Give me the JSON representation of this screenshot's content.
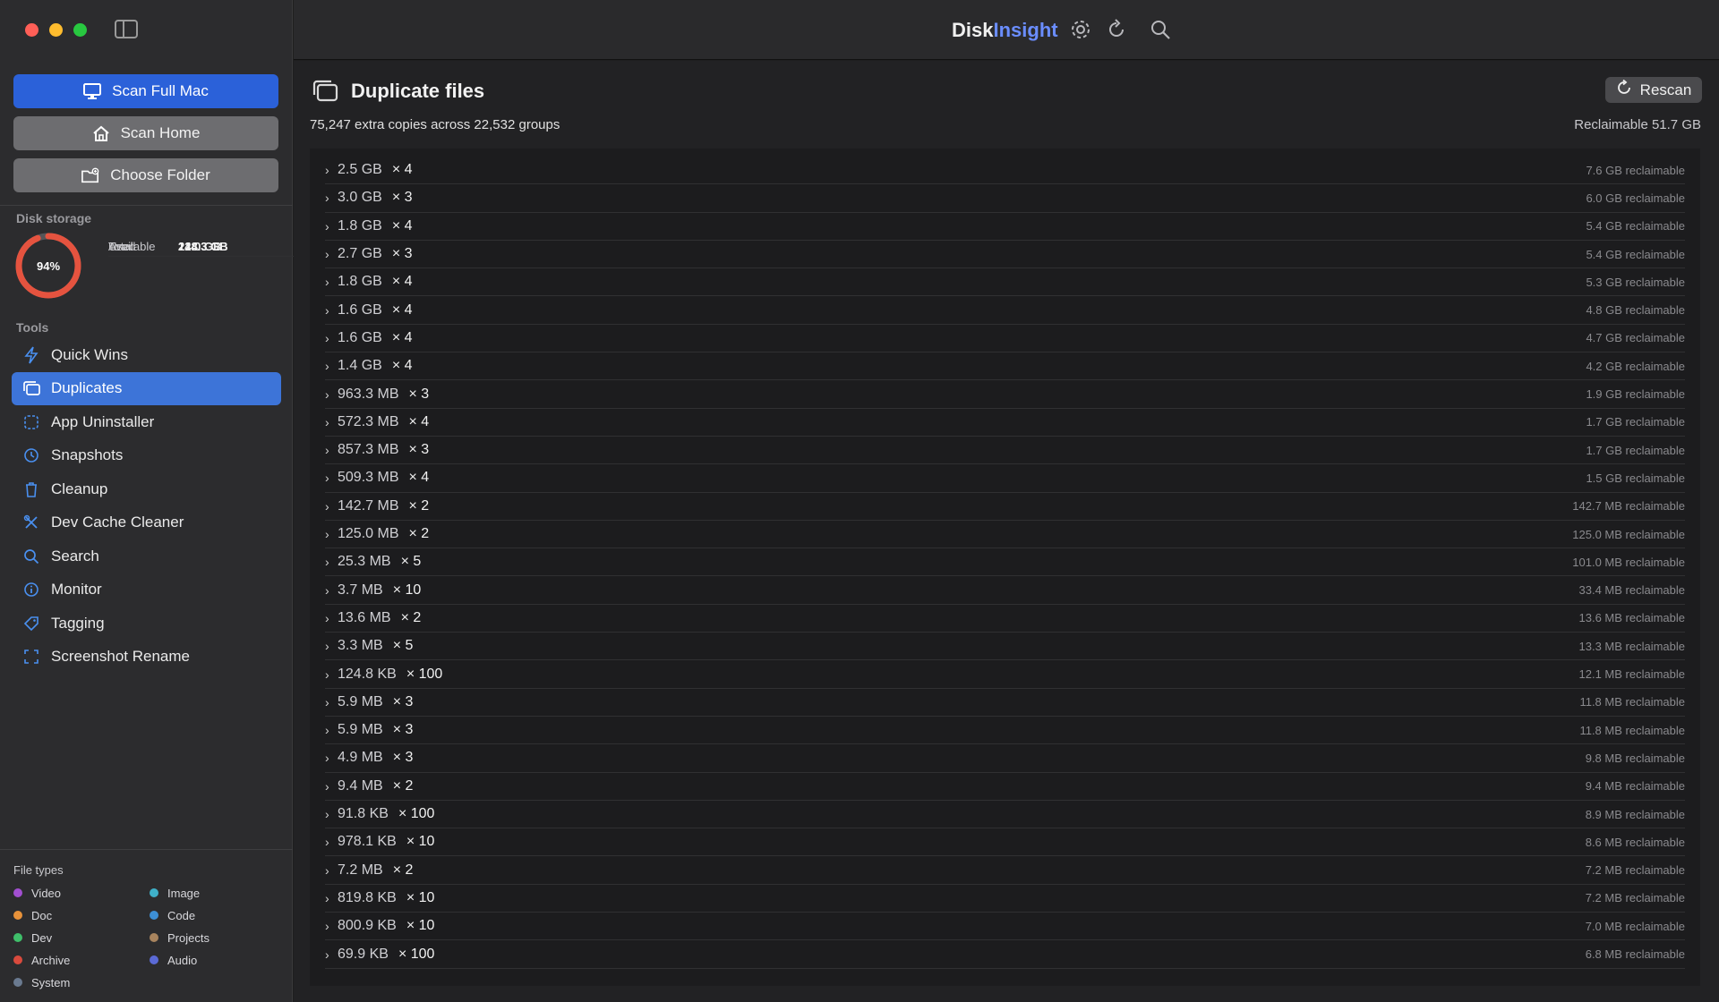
{
  "app": {
    "brand_part1": "Disk",
    "brand_part2": "Insight"
  },
  "sidebar": {
    "scan_full": "Scan Full Mac",
    "scan_home": "Scan Home",
    "choose_folder": "Choose Folder",
    "disk_title": "Disk storage",
    "disk_percent": "94%",
    "disk_used_fraction": 0.94,
    "stats": {
      "total_label": "Total",
      "total": "228.3 GB",
      "used_label": "Used",
      "used": "214.3 GB",
      "available_label": "Available",
      "available": "14.0 GB"
    },
    "tools_title": "Tools",
    "tools": [
      {
        "label": "Quick Wins",
        "icon": "bolt-icon"
      },
      {
        "label": "Duplicates",
        "icon": "duplicates-icon",
        "active": true
      },
      {
        "label": "App Uninstaller",
        "icon": "app-icon"
      },
      {
        "label": "Snapshots",
        "icon": "clock-icon"
      },
      {
        "label": "Cleanup",
        "icon": "trash-icon"
      },
      {
        "label": "Dev Cache Cleaner",
        "icon": "tools-icon"
      },
      {
        "label": "Search",
        "icon": "search-icon"
      },
      {
        "label": "Monitor",
        "icon": "info-icon"
      },
      {
        "label": "Tagging",
        "icon": "tag-icon"
      },
      {
        "label": "Screenshot Rename",
        "icon": "screenshot-icon"
      }
    ],
    "filetypes_title": "File types",
    "filetypes": [
      {
        "label": "Video",
        "color": "#a24fd0"
      },
      {
        "label": "Image",
        "color": "#3fb0c8"
      },
      {
        "label": "Doc",
        "color": "#e8923a"
      },
      {
        "label": "Code",
        "color": "#3d8fd6"
      },
      {
        "label": "Dev",
        "color": "#3fbf6a"
      },
      {
        "label": "Projects",
        "color": "#a8845e"
      },
      {
        "label": "Archive",
        "color": "#d94a3d"
      },
      {
        "label": "Audio",
        "color": "#5b6ad6"
      },
      {
        "label": "System",
        "color": "#6a7a90"
      }
    ]
  },
  "main": {
    "title": "Duplicate files",
    "rescan": "Rescan",
    "summary": "75,247 extra copies across 22,532 groups",
    "reclaimable": "Reclaimable 51.7 GB",
    "rows": [
      {
        "size": "2.5 GB",
        "count": "× 4",
        "reclaim": "7.6 GB reclaimable"
      },
      {
        "size": "3.0 GB",
        "count": "× 3",
        "reclaim": "6.0 GB reclaimable"
      },
      {
        "size": "1.8 GB",
        "count": "× 4",
        "reclaim": "5.4 GB reclaimable"
      },
      {
        "size": "2.7 GB",
        "count": "× 3",
        "reclaim": "5.4 GB reclaimable"
      },
      {
        "size": "1.8 GB",
        "count": "× 4",
        "reclaim": "5.3 GB reclaimable"
      },
      {
        "size": "1.6 GB",
        "count": "× 4",
        "reclaim": "4.8 GB reclaimable"
      },
      {
        "size": "1.6 GB",
        "count": "× 4",
        "reclaim": "4.7 GB reclaimable"
      },
      {
        "size": "1.4 GB",
        "count": "× 4",
        "reclaim": "4.2 GB reclaimable"
      },
      {
        "size": "963.3 MB",
        "count": "× 3",
        "reclaim": "1.9 GB reclaimable"
      },
      {
        "size": "572.3 MB",
        "count": "× 4",
        "reclaim": "1.7 GB reclaimable"
      },
      {
        "size": "857.3 MB",
        "count": "× 3",
        "reclaim": "1.7 GB reclaimable"
      },
      {
        "size": "509.3 MB",
        "count": "× 4",
        "reclaim": "1.5 GB reclaimable"
      },
      {
        "size": "142.7 MB",
        "count": "× 2",
        "reclaim": "142.7 MB reclaimable"
      },
      {
        "size": "125.0 MB",
        "count": "× 2",
        "reclaim": "125.0 MB reclaimable"
      },
      {
        "size": "25.3 MB",
        "count": "× 5",
        "reclaim": "101.0 MB reclaimable"
      },
      {
        "size": "3.7 MB",
        "count": "× 10",
        "reclaim": "33.4 MB reclaimable"
      },
      {
        "size": "13.6 MB",
        "count": "× 2",
        "reclaim": "13.6 MB reclaimable"
      },
      {
        "size": "3.3 MB",
        "count": "× 5",
        "reclaim": "13.3 MB reclaimable"
      },
      {
        "size": "124.8 KB",
        "count": "× 100",
        "reclaim": "12.1 MB reclaimable"
      },
      {
        "size": "5.9 MB",
        "count": "× 3",
        "reclaim": "11.8 MB reclaimable"
      },
      {
        "size": "5.9 MB",
        "count": "× 3",
        "reclaim": "11.8 MB reclaimable"
      },
      {
        "size": "4.9 MB",
        "count": "× 3",
        "reclaim": "9.8 MB reclaimable"
      },
      {
        "size": "9.4 MB",
        "count": "× 2",
        "reclaim": "9.4 MB reclaimable"
      },
      {
        "size": "91.8 KB",
        "count": "× 100",
        "reclaim": "8.9 MB reclaimable"
      },
      {
        "size": "978.1 KB",
        "count": "× 10",
        "reclaim": "8.6 MB reclaimable"
      },
      {
        "size": "7.2 MB",
        "count": "× 2",
        "reclaim": "7.2 MB reclaimable"
      },
      {
        "size": "819.8 KB",
        "count": "× 10",
        "reclaim": "7.2 MB reclaimable"
      },
      {
        "size": "800.9 KB",
        "count": "× 10",
        "reclaim": "7.0 MB reclaimable"
      },
      {
        "size": "69.9 KB",
        "count": "× 100",
        "reclaim": "6.8 MB reclaimable"
      }
    ]
  }
}
